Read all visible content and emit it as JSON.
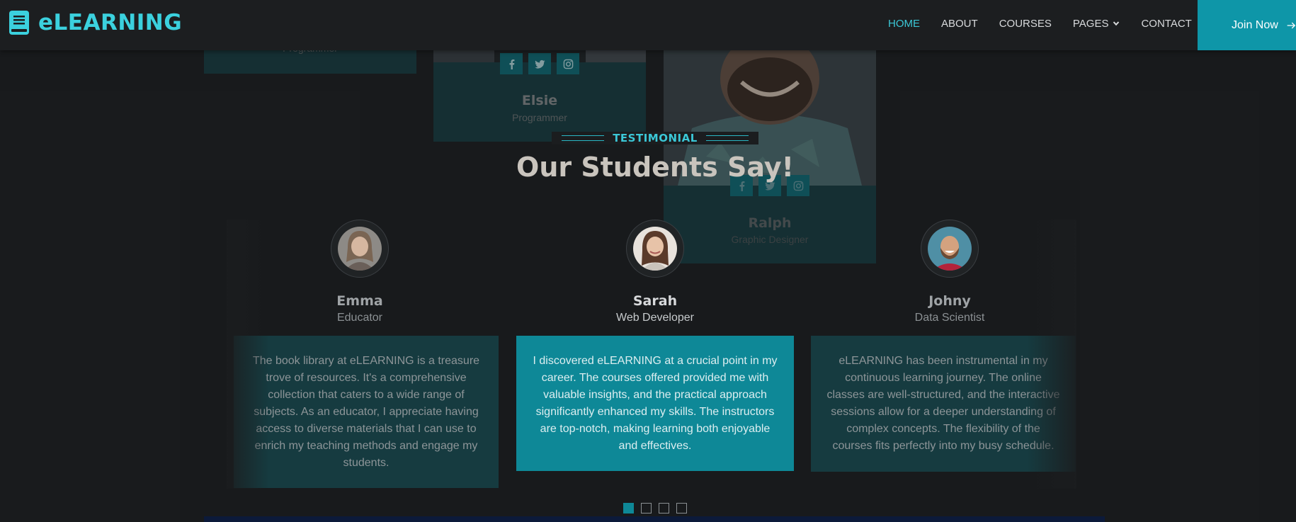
{
  "brand": {
    "name": "eLEARNING",
    "icon": "book-icon",
    "color": "#3bd1de"
  },
  "nav": {
    "items": [
      {
        "label": "HOME",
        "active": true
      },
      {
        "label": "ABOUT",
        "active": false
      },
      {
        "label": "COURSES",
        "active": false
      },
      {
        "label": "PAGES",
        "active": false,
        "dropdown": true
      },
      {
        "label": "CONTACT",
        "active": false
      }
    ],
    "cta": "Join Now",
    "accent": "#0e96a8"
  },
  "team": {
    "members": [
      {
        "name": "",
        "role": "Programmer"
      },
      {
        "name": "Elsie",
        "role": "Programmer"
      },
      {
        "name": "Ralph",
        "role": "Graphic Designer"
      }
    ],
    "socials": [
      "facebook-icon",
      "twitter-icon",
      "instagram-icon"
    ]
  },
  "testimonial": {
    "eyebrow": "TESTIMONIAL",
    "heading": "Our Students Say!",
    "items": [
      {
        "name": "Emma",
        "role": "Educator",
        "text": "The book library at eLEARNING is a treasure trove of resources. It's a comprehensive collection that caters to a wide range of subjects. As an educator, I appreciate having access to diverse materials that I can use to enrich my teaching methods and engage my students."
      },
      {
        "name": "Sarah",
        "role": "Web Developer",
        "text": "I discovered eLEARNING at a crucial point in my career. The courses offered provided me with valuable insights, and the practical approach significantly enhanced my skills. The instructors are top-notch, making learning both enjoyable and effectives."
      },
      {
        "name": "Johny",
        "role": "Data Scientist",
        "text": "eLEARNING has been instrumental in my continuous learning journey. The online classes are well-structured, and the interactive sessions allow for a deeper understanding of complex concepts. The flexibility of the courses fits perfectly into my busy schedule."
      }
    ],
    "pagination": {
      "count": 4,
      "active": 1
    },
    "active_color": "#0e8897"
  }
}
